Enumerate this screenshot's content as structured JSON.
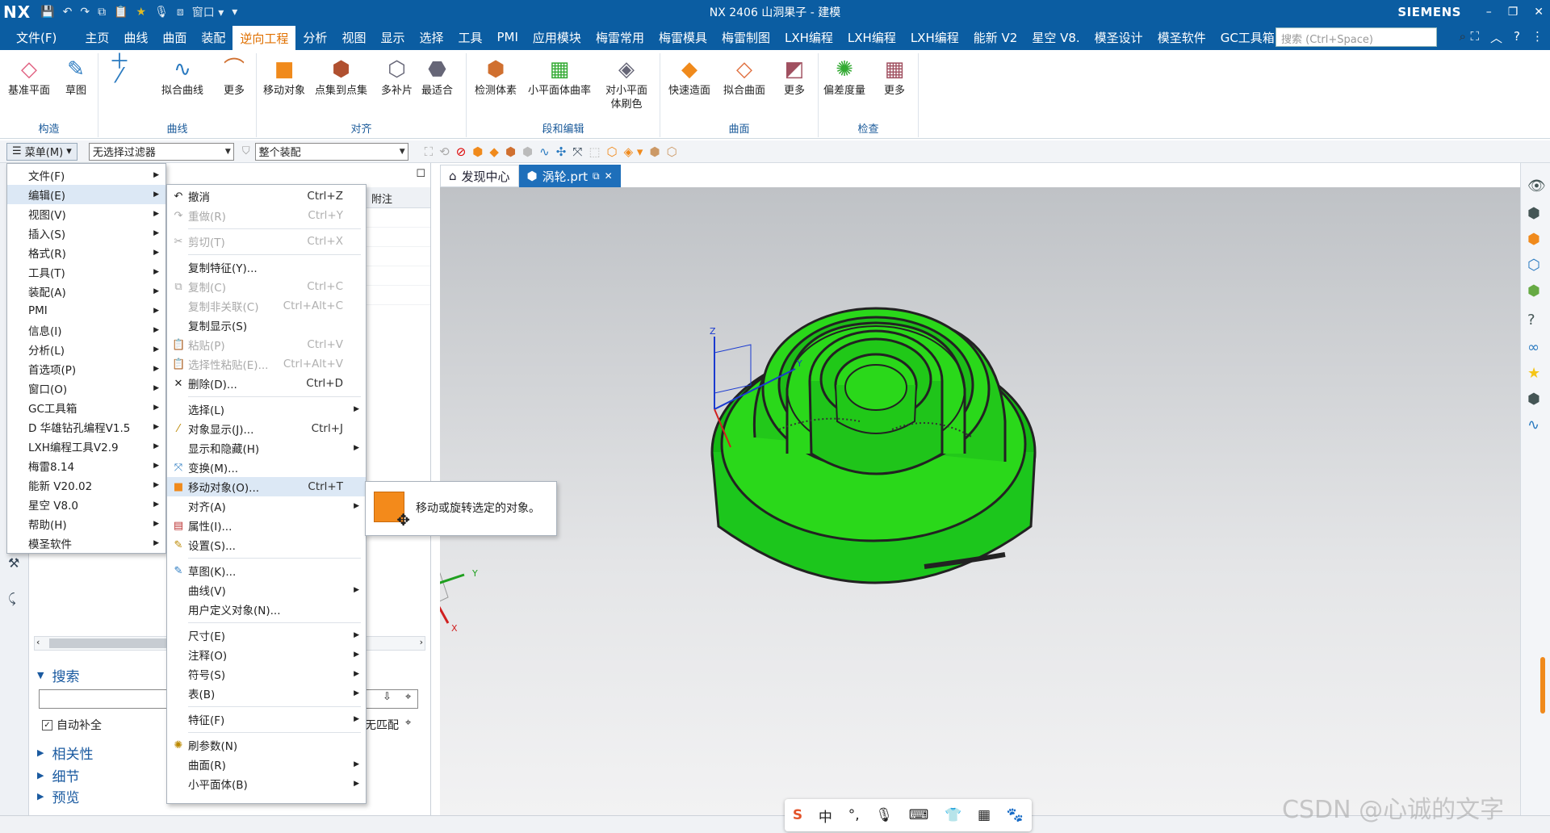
{
  "titlebar": {
    "logo": "NX",
    "title": "NX 2406 山洞果子 - 建模",
    "brand": "SIEMENS",
    "window_menu_label": "窗口"
  },
  "ribbon_tabs": [
    "文件(F)",
    "主页",
    "曲线",
    "曲面",
    "装配",
    "逆向工程",
    "分析",
    "视图",
    "显示",
    "选择",
    "工具",
    "PMI",
    "应用模块",
    "梅雷常用",
    "梅雷模具",
    "梅雷制图",
    "LXH编程",
    "LXH编程",
    "LXH编程",
    "能新 V2",
    "星空 V8.",
    "模圣设计",
    "模圣软件",
    "GC工具箱"
  ],
  "active_tab_index": 5,
  "search_placeholder": "搜索 (Ctrl+Space)",
  "ribbon": {
    "groups": [
      {
        "label": "构造",
        "buttons": [
          "基准平面",
          "草图"
        ]
      },
      {
        "label": "曲线",
        "buttons": [
          "拟合曲线",
          "更多"
        ]
      },
      {
        "label": "对齐",
        "buttons": [
          "移动对象",
          "点集到点集",
          "多补片",
          "最适合"
        ]
      },
      {
        "label": "段和编辑",
        "buttons": [
          "检测体素",
          "小平面体曲率",
          "对小平面体刷色"
        ]
      },
      {
        "label": "曲面",
        "buttons": [
          "快速造面",
          "拟合曲面",
          "更多"
        ]
      },
      {
        "label": "检查",
        "buttons": [
          "偏差度量",
          "更多"
        ]
      }
    ]
  },
  "toolbar2": {
    "menu_label": "菜单(M)",
    "filter_value": "无选择过滤器",
    "scope_value": "整个装配"
  },
  "navigator": {
    "column_header": "附注",
    "sections": {
      "search": "搜索",
      "autocomplete": "自动补全",
      "no_match": "无匹配",
      "dependencies": "相关性",
      "details": "细节",
      "preview": "预览"
    }
  },
  "doc_tabs": {
    "home": "发现中心",
    "active": "涡轮.prt"
  },
  "main_menu": [
    "文件(F)",
    "编辑(E)",
    "视图(V)",
    "插入(S)",
    "格式(R)",
    "工具(T)",
    "装配(A)",
    "PMI",
    "信息(I)",
    "分析(L)",
    "首选项(P)",
    "窗口(O)",
    "GC工具箱",
    "D 华雄钻孔编程V1.5",
    "LXH编程工具V2.9",
    "梅雷8.14",
    "能新 V20.02",
    "星空 V8.0",
    "帮助(H)",
    "模圣软件"
  ],
  "edit_menu": [
    {
      "label": "撤消",
      "shortcut": "Ctrl+Z",
      "icon": "undo-icon",
      "disabled": false
    },
    {
      "label": "重做(R)",
      "shortcut": "Ctrl+Y",
      "icon": "redo-icon",
      "disabled": true
    },
    {
      "label": "剪切(T)",
      "shortcut": "Ctrl+X",
      "icon": "cut-icon",
      "disabled": true
    },
    {
      "label": "复制特征(Y)...",
      "shortcut": "",
      "disabled": false
    },
    {
      "label": "复制(C)",
      "shortcut": "Ctrl+C",
      "icon": "copy-icon",
      "disabled": true
    },
    {
      "label": "复制非关联(C)",
      "shortcut": "Ctrl+Alt+C",
      "disabled": true
    },
    {
      "label": "复制显示(S)",
      "shortcut": "",
      "disabled": false
    },
    {
      "label": "粘贴(P)",
      "shortcut": "Ctrl+V",
      "icon": "paste-icon",
      "disabled": true
    },
    {
      "label": "选择性粘贴(E)...",
      "shortcut": "Ctrl+Alt+V",
      "icon": "paste-special-icon",
      "disabled": true
    },
    {
      "label": "删除(D)...",
      "shortcut": "Ctrl+D",
      "icon": "delete-icon",
      "disabled": false
    },
    {
      "label": "选择(L)",
      "submenu": true
    },
    {
      "label": "对象显示(J)...",
      "shortcut": "Ctrl+J",
      "icon": "brush-icon"
    },
    {
      "label": "显示和隐藏(H)",
      "submenu": true
    },
    {
      "label": "变换(M)...",
      "icon": "transform-icon"
    },
    {
      "label": "移动对象(O)...",
      "shortcut": "Ctrl+T",
      "icon": "move-object-icon"
    },
    {
      "label": "对齐(A)",
      "submenu": true
    },
    {
      "label": "属性(I)...",
      "icon": "properties-icon"
    },
    {
      "label": "设置(S)...",
      "icon": "settings-icon"
    },
    {
      "label": "草图(K)...",
      "icon": "sketch-icon"
    },
    {
      "label": "曲线(V)",
      "submenu": true
    },
    {
      "label": "用户定义对象(N)..."
    },
    {
      "label": "尺寸(E)",
      "submenu": true
    },
    {
      "label": "注释(O)",
      "submenu": true
    },
    {
      "label": "符号(S)",
      "submenu": true
    },
    {
      "label": "表(B)",
      "submenu": true
    },
    {
      "label": "特征(F)",
      "submenu": true
    },
    {
      "label": "刷参数(N)",
      "icon": "refresh-params-icon"
    },
    {
      "label": "曲面(R)",
      "submenu": true
    },
    {
      "label": "小平面体(B)",
      "submenu": true
    }
  ],
  "tooltip": {
    "text": "移动或旋转选定的对象。"
  },
  "triad": {
    "z": "Z",
    "y": "Y",
    "x": "X"
  },
  "colors": {
    "model_green": "#2ad81a",
    "accent_blue": "#0b5da2",
    "active_tab_orange": "#e07000"
  },
  "ime_bar": {
    "lang": "中"
  },
  "watermark": "CSDN @心诚的文字"
}
